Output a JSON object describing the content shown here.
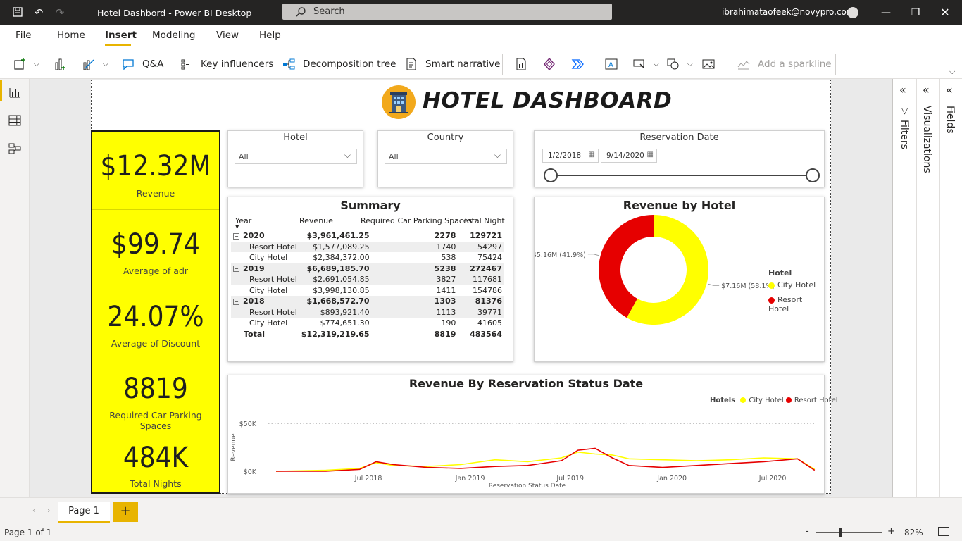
{
  "window": {
    "title": "Hotel Dashbord - Power BI Desktop",
    "search_placeholder": "Search",
    "user_email": "ibrahimataofeek@novypro.com"
  },
  "menu": [
    "File",
    "Home",
    "Insert",
    "Modeling",
    "View",
    "Help"
  ],
  "ribbon": {
    "qa": "Q&A",
    "key_influencers": "Key influencers",
    "decomposition_tree": "Decomposition tree",
    "smart_narrative": "Smart narrative",
    "add_sparkline": "Add a sparkline"
  },
  "panes": {
    "filters": "Filters",
    "visualizations": "Visualizations",
    "fields": "Fields"
  },
  "report": {
    "title": "HOTEL DASHBOARD",
    "kpis": [
      {
        "value": "$12.32M",
        "label": "Revenue"
      },
      {
        "value": "$99.74",
        "label": "Average of adr"
      },
      {
        "value": "24.07%",
        "label": "Average of Discount"
      },
      {
        "value": "8819",
        "label": "Required Car Parking Spaces"
      },
      {
        "value": "484K",
        "label": "Total Nights"
      }
    ],
    "slicers": {
      "hotel": {
        "title": "Hotel",
        "value": "All"
      },
      "country": {
        "title": "Country",
        "value": "All"
      },
      "date": {
        "title": "Reservation Date",
        "start": "1/2/2018",
        "end": "9/14/2020"
      }
    },
    "summary": {
      "title": "Summary",
      "headers": [
        "Year",
        "Revenue",
        "Required Car Parking Spaces",
        "Total Night"
      ],
      "rows": [
        {
          "label": "2020",
          "revenue": "$3,961,461.25",
          "parking": "2278",
          "nights": "129721",
          "type": "year"
        },
        {
          "label": "Resort Hotel",
          "revenue": "$1,577,089.25",
          "parking": "1740",
          "nights": "54297",
          "type": "child"
        },
        {
          "label": "City Hotel",
          "revenue": "$2,384,372.00",
          "parking": "538",
          "nights": "75424",
          "type": "child"
        },
        {
          "label": "2019",
          "revenue": "$6,689,185.70",
          "parking": "5238",
          "nights": "272467",
          "type": "year"
        },
        {
          "label": "Resort Hotel",
          "revenue": "$2,691,054.85",
          "parking": "3827",
          "nights": "117681",
          "type": "child"
        },
        {
          "label": "City Hotel",
          "revenue": "$3,998,130.85",
          "parking": "1411",
          "nights": "154786",
          "type": "child"
        },
        {
          "label": "2018",
          "revenue": "$1,668,572.70",
          "parking": "1303",
          "nights": "81376",
          "type": "year"
        },
        {
          "label": "Resort Hotel",
          "revenue": "$893,921.40",
          "parking": "1113",
          "nights": "39771",
          "type": "child"
        },
        {
          "label": "City Hotel",
          "revenue": "$774,651.30",
          "parking": "190",
          "nights": "41605",
          "type": "child"
        },
        {
          "label": "Total",
          "revenue": "$12,319,219.65",
          "parking": "8819",
          "nights": "483564",
          "type": "total"
        }
      ]
    },
    "colors": {
      "city": "#ffff00",
      "resort": "#e60000",
      "accent": "#e8b400"
    }
  },
  "chart_data": [
    {
      "type": "pie",
      "title": "Revenue by Hotel",
      "legend_title": "Hotel",
      "legend_position": "right",
      "slices": [
        {
          "name": "City Hotel",
          "value": 7.16,
          "label": "$7.16M (58.1%)",
          "color": "#ffff00"
        },
        {
          "name": "Resort Hotel",
          "value": 5.16,
          "label": "$5.16M (41.9%)",
          "color": "#e60000"
        }
      ]
    },
    {
      "type": "line",
      "title": "Revenue By Reservation Status Date",
      "xlabel": "Reservation Status Date",
      "ylabel": "Revenue",
      "legend_title": "Hotels",
      "legend_position": "top-right",
      "y_ticks": [
        "$0K",
        "$50K"
      ],
      "x_ticks": [
        "Jul 2018",
        "Jan 2019",
        "Jul 2019",
        "Jan 2020",
        "Jul 2020"
      ],
      "ylim": [
        0,
        50
      ],
      "xlim": [
        "2018-01-01",
        "2020-09-14"
      ],
      "y_unit": "K",
      "series": [
        {
          "name": "City Hotel",
          "color": "#ffff00",
          "x": [
            "2018-01",
            "2018-04",
            "2018-06",
            "2018-07",
            "2018-08",
            "2018-10",
            "2018-12",
            "2019-02",
            "2019-04",
            "2019-06",
            "2019-07",
            "2019-08",
            "2019-09",
            "2019-10",
            "2019-12",
            "2020-02",
            "2020-04",
            "2020-06",
            "2020-08",
            "2020-09"
          ],
          "values": [
            0,
            1,
            3,
            9,
            6,
            5,
            7,
            12,
            10,
            14,
            20,
            18,
            17,
            13,
            12,
            11,
            12,
            14,
            13,
            2
          ]
        },
        {
          "name": "Resort Hotel",
          "color": "#e60000",
          "x": [
            "2018-01",
            "2018-04",
            "2018-06",
            "2018-07",
            "2018-08",
            "2018-10",
            "2018-12",
            "2019-02",
            "2019-04",
            "2019-06",
            "2019-07",
            "2019-08",
            "2019-09",
            "2019-10",
            "2019-12",
            "2020-02",
            "2020-04",
            "2020-06",
            "2020-08",
            "2020-09"
          ],
          "values": [
            0,
            0,
            2,
            10,
            7,
            4,
            3,
            5,
            6,
            11,
            22,
            24,
            14,
            6,
            4,
            6,
            8,
            10,
            13,
            1
          ]
        }
      ]
    }
  ],
  "bottom": {
    "page_tab": "Page 1",
    "add": "+",
    "status": "Page 1 of 1",
    "zoom": "82%"
  }
}
